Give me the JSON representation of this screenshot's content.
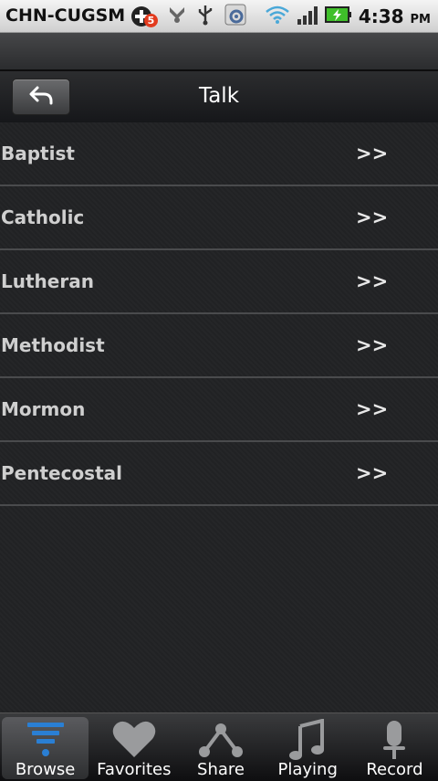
{
  "status_bar": {
    "carrier": "CHN-CUGSM",
    "notification_count": "5",
    "time": "4:38",
    "ampm": "PM"
  },
  "header": {
    "title": "Talk",
    "back_icon": "back-arrow-icon"
  },
  "list": {
    "items": [
      {
        "label": "Baptist",
        "arrow": ">>"
      },
      {
        "label": "Catholic",
        "arrow": ">>"
      },
      {
        "label": "Lutheran",
        "arrow": ">>"
      },
      {
        "label": "Methodist",
        "arrow": ">>"
      },
      {
        "label": "Mormon",
        "arrow": ">>"
      },
      {
        "label": "Pentecostal",
        "arrow": ">>"
      }
    ]
  },
  "tabs": [
    {
      "label": "Browse",
      "icon": "browse-icon",
      "active": true
    },
    {
      "label": "Favorites",
      "icon": "heart-icon",
      "active": false
    },
    {
      "label": "Share",
      "icon": "share-icon",
      "active": false
    },
    {
      "label": "Playing",
      "icon": "music-note-icon",
      "active": false
    },
    {
      "label": "Record",
      "icon": "microphone-icon",
      "active": false
    }
  ],
  "colors": {
    "accent_blue": "#2a7fd4",
    "background": "#222325",
    "battery_green": "#3fbf2a"
  }
}
